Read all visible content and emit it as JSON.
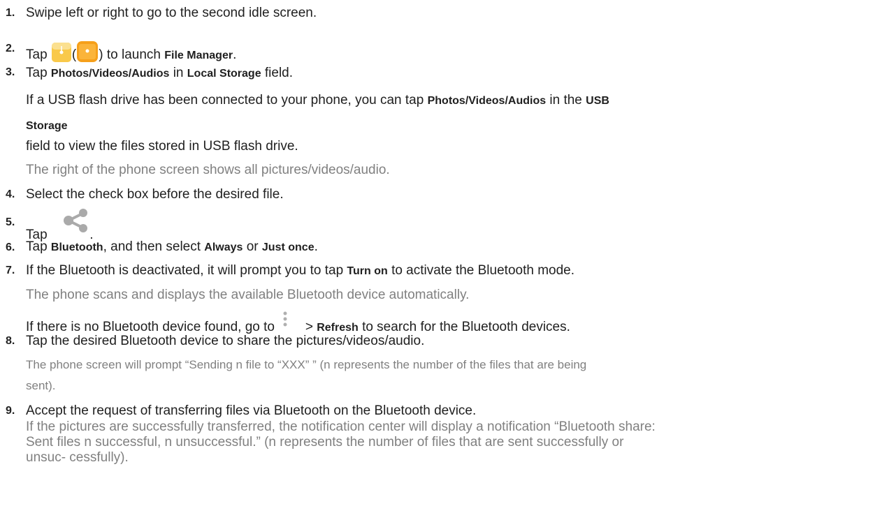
{
  "steps": [
    {
      "n": "1.",
      "text": "Swipe left or right to go to the second idle screen."
    },
    {
      "n": "2.",
      "a": "Tap",
      "b": "(",
      "c": ") to launch",
      "bold": "File Manager",
      "d": "."
    },
    {
      "n": "3.",
      "a": "Tap",
      "bold1": "Photos/Videos/Audios",
      "b": "in",
      "bold2": "Local Storage",
      "c": "field.",
      "usb_a": "If a USB flash drive has been connected to your phone, you can tap",
      "usb_bold1": "Photos/Videos/Audios",
      "usb_b": "in the",
      "usb_bold2": "USB",
      "usb_bold3": "Storage",
      "usb_c": "field to view the files stored in USB flash drive.",
      "note": "The right of the phone screen shows all pictures/videos/audio."
    },
    {
      "n": "4.",
      "text": "Select the check box before the desired file."
    },
    {
      "n": "5.",
      "a": "Tap",
      "b": "."
    },
    {
      "n": "6.",
      "a": "Tap",
      "bold1": "Bluetooth",
      "b": ", and then select",
      "bold2": "Always",
      "c": "or",
      "bold3": "Just once",
      "d": "."
    },
    {
      "n": "7.",
      "a": "If the Bluetooth is deactivated, it will prompt you to tap",
      "bold": "Turn on",
      "b": "to activate the Bluetooth mode.",
      "note": "The phone scans and displays the available Bluetooth device automatically.",
      "extra_a": "If there is no Bluetooth device found, go to",
      "extra_b": ">",
      "extra_bold": "Refresh",
      "extra_c": "to search for the Bluetooth devices."
    },
    {
      "n": "8.",
      "text": "Tap the desired Bluetooth device to share the pictures/videos/audio.",
      "note1": "The phone screen will prompt “Sending n file to “XXX” ” (n represents the number of the files that are being",
      "note2": "sent)."
    },
    {
      "n": "9.",
      "text": "Accept the request of transferring files via Bluetooth on the Bluetooth device.",
      "note1": "If the pictures are successfully transferred, the notification center will display a notification “Bluetooth share:",
      "note2": "Sent files n successful, n unsuccessful.” (n represents the number of files that are sent successfully or",
      "note3": "unsuc- cessfully)."
    }
  ],
  "icons": {
    "file_manager_old": "file-manager-icon",
    "file_manager_new": "file-manager-icon",
    "share": "share-icon",
    "more": "more-vert-icon"
  },
  "colors": {
    "text": "#1f1f1f",
    "note": "#808080",
    "icon_orange": "#f7a21b",
    "icon_gray": "#b0b0b0"
  }
}
